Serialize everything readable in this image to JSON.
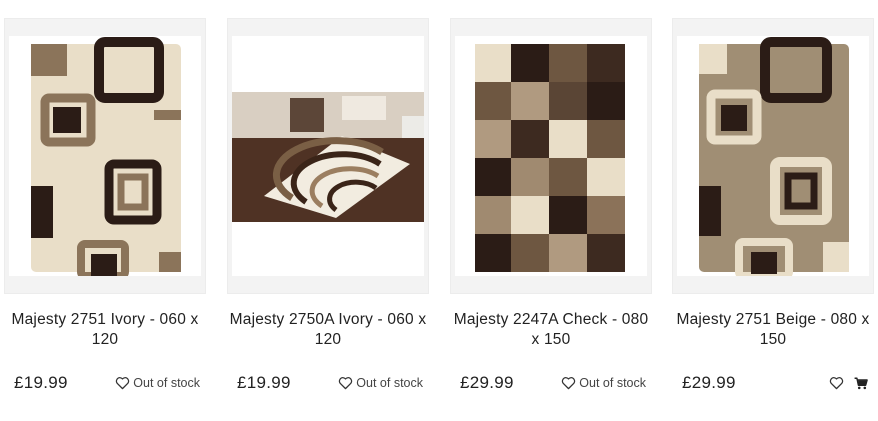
{
  "products": [
    {
      "title": "Majesty 2751 Ivory - 060 x 120",
      "price": "£19.99",
      "stock": "Out of stock",
      "image_icon": "rug-ivory-squares-image"
    },
    {
      "title": "Majesty 2750A Ivory - 060 x 120",
      "price": "£19.99",
      "stock": "Out of stock",
      "image_icon": "rug-ivory-arcs-room-image"
    },
    {
      "title": "Majesty 2247A Check - 080 x 150",
      "price": "£29.99",
      "stock": "Out of stock",
      "image_icon": "rug-check-image"
    },
    {
      "title": "Majesty 2751 Beige - 080 x 150",
      "price": "£29.99",
      "stock": "",
      "image_icon": "rug-beige-squares-image"
    }
  ],
  "icons": {
    "wishlist": "heart-icon",
    "cart": "cart-icon"
  },
  "colors": {
    "ivory": "#e8dcc6",
    "beige": "#a08e74",
    "dark_brown": "#2b1c16",
    "mid_brown": "#7a5f45",
    "panel": "#f3f3f3"
  }
}
